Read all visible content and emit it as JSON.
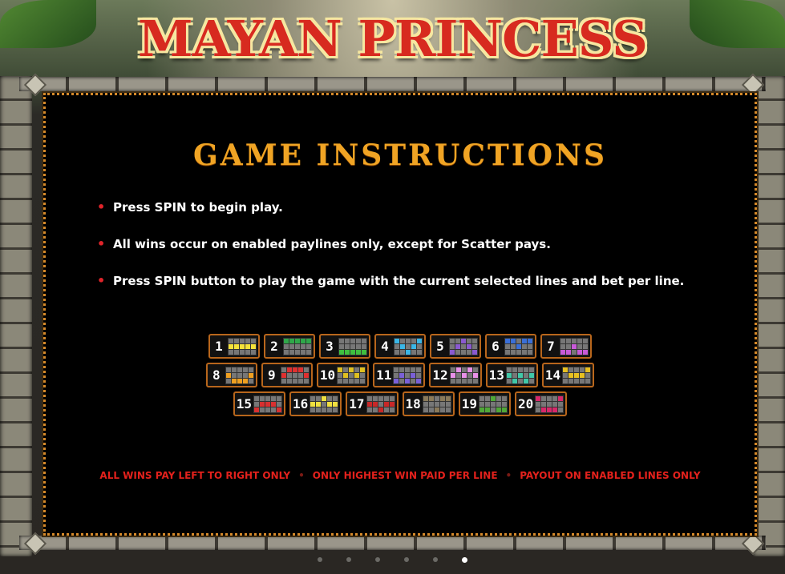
{
  "title": "MAYAN PRINCESS",
  "heading": "GAME INSTRUCTIONS",
  "instructions": [
    "Press SPIN to begin play.",
    "All wins occur on enabled paylines only, except for Scatter pays.",
    "Press SPIN button to play the game with the current selected lines and bet per line."
  ],
  "paylines": [
    {
      "num": "1",
      "color": "#f5e23a",
      "cells": [
        5,
        6,
        7,
        8,
        9
      ]
    },
    {
      "num": "2",
      "color": "#2fa84a",
      "cells": [
        0,
        1,
        2,
        3,
        4
      ]
    },
    {
      "num": "3",
      "color": "#3fbf3f",
      "cells": [
        10,
        11,
        12,
        13,
        14
      ]
    },
    {
      "num": "4",
      "color": "#3ab6e6",
      "cells": [
        0,
        6,
        12,
        8,
        4
      ]
    },
    {
      "num": "5",
      "color": "#8a5ad0",
      "cells": [
        10,
        6,
        2,
        8,
        14
      ]
    },
    {
      "num": "6",
      "color": "#3a6fd8",
      "cells": [
        0,
        1,
        7,
        3,
        4
      ]
    },
    {
      "num": "7",
      "color": "#c85ad8",
      "cells": [
        10,
        11,
        7,
        13,
        14
      ]
    },
    {
      "num": "8",
      "color": "#f0a020",
      "cells": [
        5,
        11,
        12,
        13,
        9
      ]
    },
    {
      "num": "9",
      "color": "#e03030",
      "cells": [
        5,
        1,
        2,
        3,
        9
      ]
    },
    {
      "num": "10",
      "color": "#e0c020",
      "cells": [
        0,
        6,
        2,
        8,
        4
      ]
    },
    {
      "num": "11",
      "color": "#7a60d8",
      "cells": [
        10,
        6,
        12,
        8,
        14
      ]
    },
    {
      "num": "12",
      "color": "#e890e8",
      "cells": [
        5,
        1,
        7,
        3,
        9
      ]
    },
    {
      "num": "13",
      "color": "#40c8a8",
      "cells": [
        5,
        11,
        7,
        13,
        9
      ]
    },
    {
      "num": "14",
      "color": "#e8c020",
      "cells": [
        0,
        6,
        7,
        8,
        4
      ]
    },
    {
      "num": "15",
      "color": "#d83030",
      "cells": [
        10,
        6,
        7,
        8,
        14
      ]
    },
    {
      "num": "16",
      "color": "#f0e040",
      "cells": [
        5,
        6,
        2,
        8,
        9
      ]
    },
    {
      "num": "17",
      "color": "#c82828",
      "cells": [
        5,
        6,
        12,
        8,
        9
      ]
    },
    {
      "num": "18",
      "color": "#8a7a5a",
      "cells": [
        0,
        1,
        12,
        3,
        4
      ]
    },
    {
      "num": "19",
      "color": "#50a838",
      "cells": [
        10,
        11,
        2,
        13,
        14
      ]
    },
    {
      "num": "20",
      "color": "#d8286a",
      "cells": [
        0,
        11,
        12,
        13,
        4
      ]
    }
  ],
  "footer": [
    "ALL WINS PAY LEFT TO RIGHT ONLY",
    "ONLY HIGHEST WIN PAID PER LINE",
    "PAYOUT ON ENABLED LINES ONLY"
  ],
  "page_dots": {
    "count": 6,
    "active": 5
  }
}
